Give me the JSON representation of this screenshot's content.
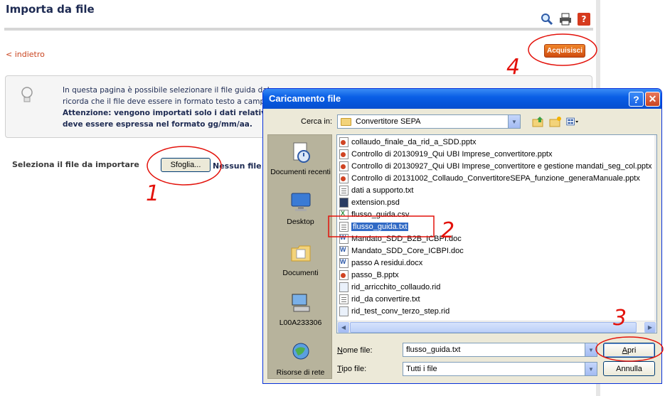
{
  "page": {
    "title": "Importa da file",
    "back_link": "< indietro",
    "acquire_button": "Acquisisci",
    "info_line1": "In questa pagina è possibile selezionare il file guida dal qu",
    "info_line2": "ricorda che il file deve essere in formato testo a campi s",
    "info_line3": "Attenzione: vengono importati solo i dati relativi a m",
    "info_line4": "deve essere espressa nel formato gg/mm/aa.",
    "select_label": "Seleziona il file da importare",
    "browse_button": "Sfoglia...",
    "no_file_text": "Nessun file s",
    "icons": [
      "search-icon",
      "print-icon",
      "help-icon"
    ]
  },
  "dialog": {
    "title": "Caricamento file",
    "look_in_label": "Cerca in:",
    "look_in_value": "Convertitore SEPA",
    "places": [
      "Documenti recenti",
      "Desktop",
      "Documenti",
      "L00A233306",
      "Risorse di rete"
    ],
    "files": [
      {
        "name": "collaudo_finale_da_rid_a_SDD.pptx",
        "type": "ppt"
      },
      {
        "name": "Controllo di 20130919_Qui UBI Imprese_convertitore.pptx",
        "type": "ppt"
      },
      {
        "name": "Controllo di 20130927_Qui UBI Imprese_convertitore e gestione mandati_seg_col.pptx",
        "type": "ppt"
      },
      {
        "name": "Controllo di 20131002_Collaudo_ConvertitoreSEPA_funzione_generaManuale.pptx",
        "type": "ppt"
      },
      {
        "name": "dati a supporto.txt",
        "type": "txt"
      },
      {
        "name": "extension.psd",
        "type": "psd"
      },
      {
        "name": "flusso_guida.csv",
        "type": "csv"
      },
      {
        "name": "flusso_guida.txt",
        "type": "txt"
      },
      {
        "name": "Mandato_SDD_B2B_ICBPI.doc",
        "type": "doc"
      },
      {
        "name": "Mandato_SDD_Core_ICBPI.doc",
        "type": "doc"
      },
      {
        "name": "passo A residui.docx",
        "type": "doc"
      },
      {
        "name": "passo_B.pptx",
        "type": "ppt"
      },
      {
        "name": "rid_arricchito_collaudo.rid",
        "type": "rid"
      },
      {
        "name": "rid_da convertire.txt",
        "type": "txt"
      },
      {
        "name": "rid_test_conv_terzo_step.rid",
        "type": "rid"
      }
    ],
    "selected_file": "flusso_guida.txt",
    "file_name_label": "Nome file:",
    "file_name_value": "flusso_guida.txt",
    "file_type_label": "Tipo file:",
    "file_type_value": "Tutti i file",
    "open_button": "Apri",
    "cancel_button": "Annulla",
    "help_button": "?",
    "close_button": "✕"
  },
  "annotations": {
    "step1": "1",
    "step2": "2",
    "step3": "3",
    "step4": "4"
  },
  "colors": {
    "title_text": "#1d2a52",
    "accent_orange": "#cf4b10",
    "annotation_red": "#e3120b",
    "xp_blue": "#0553d7",
    "selection": "#316ac5"
  }
}
